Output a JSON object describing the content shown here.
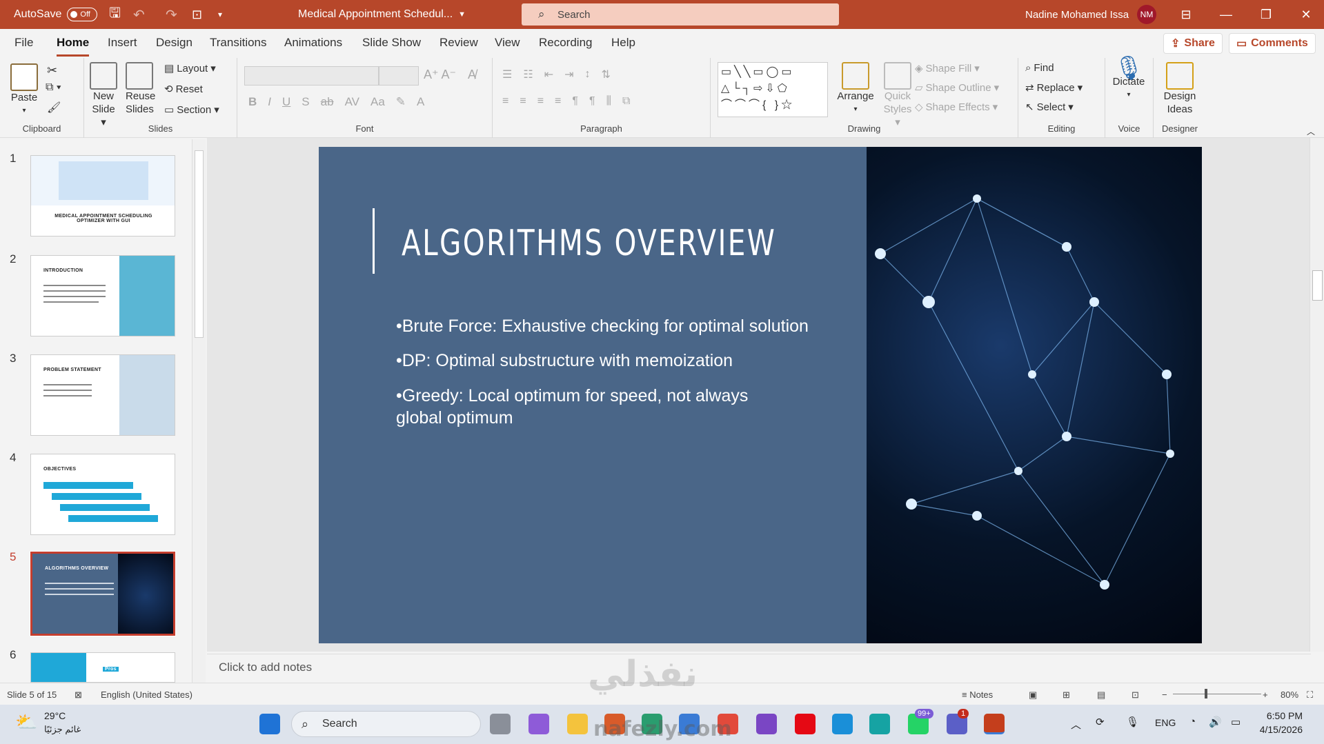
{
  "titlebar": {
    "autosave_label": "AutoSave",
    "autosave_state": "Off",
    "doc_title": "Medical Appointment Schedul...",
    "search_placeholder": "Search",
    "user_name": "Nadine Mohamed Issa",
    "user_initials": "NM",
    "brand_color": "#b7472a"
  },
  "menu": {
    "items": [
      "File",
      "Home",
      "Insert",
      "Design",
      "Transitions",
      "Animations",
      "Slide Show",
      "Review",
      "View",
      "Recording",
      "Help"
    ],
    "active": "Home",
    "share_label": "Share",
    "comments_label": "Comments"
  },
  "ribbon": {
    "clipboard": {
      "paste": "Paste",
      "group": "Clipboard"
    },
    "slides": {
      "new_slide": "New",
      "new_slide2": "Slide",
      "reuse": "Reuse",
      "reuse2": "Slides",
      "layout": "Layout",
      "reset": "Reset",
      "section": "Section",
      "group": "Slides"
    },
    "font": {
      "group": "Font"
    },
    "paragraph": {
      "group": "Paragraph"
    },
    "drawing": {
      "arrange": "Arrange",
      "quick": "Quick",
      "quick2": "Styles",
      "shape_fill": "Shape Fill",
      "shape_outline": "Shape Outline",
      "shape_effects": "Shape Effects",
      "group": "Drawing"
    },
    "editing": {
      "find": "Find",
      "replace": "Replace",
      "select": "Select",
      "group": "Editing"
    },
    "voice": {
      "dictate": "Dictate",
      "group": "Voice"
    },
    "designer": {
      "design": "Design",
      "ideas": "Ideas",
      "group": "Designer"
    }
  },
  "thumbnails": [
    {
      "num": "1",
      "title": "MEDICAL APPOINTMENT SCHEDULING OPTIMIZER WITH GUI"
    },
    {
      "num": "2",
      "title": "INTRODUCTION"
    },
    {
      "num": "3",
      "title": "PROBLEM STATEMENT"
    },
    {
      "num": "4",
      "title": "OBJECTIVES"
    },
    {
      "num": "5",
      "title": "ALGORITHMS OVERVIEW"
    },
    {
      "num": "6",
      "title": "Pros"
    }
  ],
  "slide": {
    "title": "ALGORITHMS OVERVIEW",
    "bullets": [
      "•Brute Force: Exhaustive checking for optimal solution",
      "•DP: Optimal substructure with memoization",
      "•Greedy: Local optimum for speed, not always global optimum"
    ],
    "bg_color": "#4a6688"
  },
  "notes": {
    "placeholder": "Click to add notes"
  },
  "status": {
    "slide_of": "Slide 5 of 15",
    "language": "English (United States)",
    "notes_btn": "Notes",
    "zoom": "80%"
  },
  "taskbar": {
    "weather_temp": "29°C",
    "weather_desc": "غائم جزئيًا",
    "search": "Search",
    "lang": "ENG",
    "time": "6:50 PM",
    "date": "4/15/2026",
    "whatsapp_badge": "99+",
    "teams_badge": "1"
  },
  "watermark": {
    "text_ar": "نفذلي",
    "text_en": "nafezly.com"
  }
}
